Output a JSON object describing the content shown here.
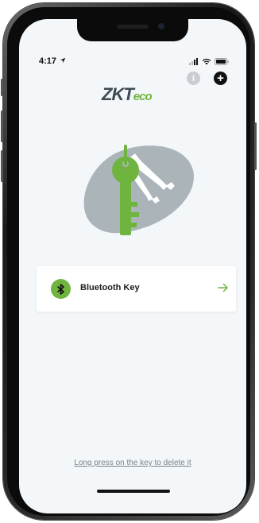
{
  "status_bar": {
    "time": "4:17",
    "location_icon": "location-arrow-icon",
    "signal_icon": "cellular-signal-icon",
    "wifi_icon": "wifi-icon",
    "battery_icon": "battery-icon"
  },
  "header": {
    "info_label": "i",
    "add_label": "+",
    "info_icon": "info-icon",
    "add_icon": "plus-icon"
  },
  "logo": {
    "text_main": "ZKT",
    "text_eco": "eco"
  },
  "hero": {
    "icon": "keys-illustration-icon"
  },
  "keys": [
    {
      "label": "Bluetooth Key",
      "icon": "bluetooth-icon",
      "action_icon": "arrow-right-icon"
    }
  ],
  "footer": {
    "hint": "Long press on the key to delete it"
  },
  "colors": {
    "accent_green": "#6fb43f",
    "logo_grey": "#3d4b52",
    "screen_bg": "#f3f7f9",
    "hint_text": "#7a8389",
    "hero_blob": "#aab4b9"
  }
}
